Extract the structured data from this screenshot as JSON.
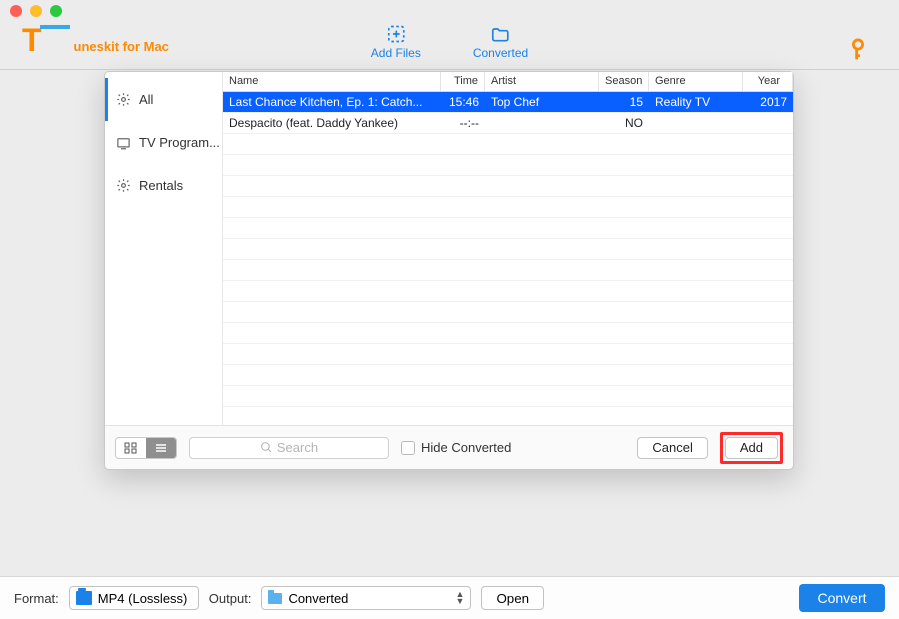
{
  "app": {
    "name": "uneskit for Mac"
  },
  "toolbar": {
    "addFiles": "Add Files",
    "converted": "Converted"
  },
  "sidebar": {
    "items": [
      {
        "label": "All"
      },
      {
        "label": "TV Program..."
      },
      {
        "label": "Rentals"
      }
    ]
  },
  "table": {
    "headers": {
      "name": "Name",
      "time": "Time",
      "artist": "Artist",
      "season": "Season",
      "genre": "Genre",
      "year": "Year"
    },
    "rows": [
      {
        "name": "Last Chance Kitchen, Ep. 1: Catch...",
        "time": "15:46",
        "artist": "Top Chef",
        "season": "15",
        "genre": "Reality TV",
        "year": "2017",
        "selected": true
      },
      {
        "name": "Despacito (feat. Daddy Yankee)",
        "time": "--:--",
        "artist": "",
        "season": "NO",
        "genre": "",
        "year": "",
        "selected": false
      }
    ]
  },
  "dialogFooter": {
    "searchPlaceholder": "Search",
    "hideConverted": "Hide Converted",
    "cancel": "Cancel",
    "add": "Add"
  },
  "bottombar": {
    "formatLabel": "Format:",
    "formatValue": "MP4 (Lossless)",
    "outputLabel": "Output:",
    "outputValue": "Converted",
    "open": "Open",
    "convert": "Convert"
  }
}
